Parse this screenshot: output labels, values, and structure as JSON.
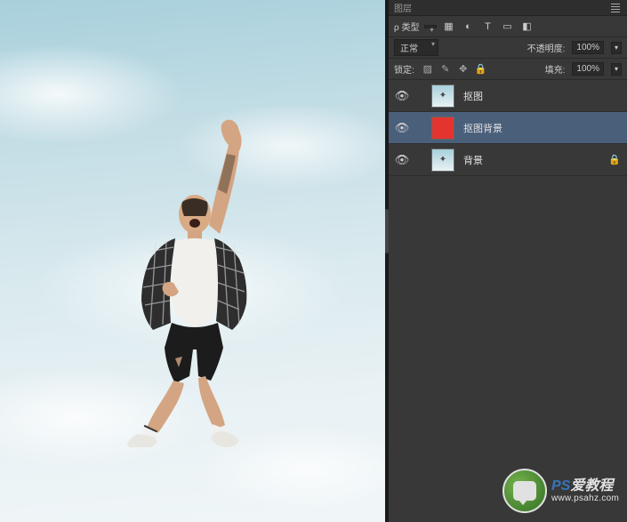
{
  "panel": {
    "tab_label": "图层",
    "filter_label": "ρ 类型",
    "filter_icons": [
      "image-icon",
      "adjustment-icon",
      "text-icon",
      "shape-icon",
      "smartobject-icon"
    ],
    "blend_mode": "正常",
    "opacity_label": "不透明度:",
    "opacity_value": "100%",
    "lock_label": "锁定:",
    "fill_label": "填充:",
    "fill_value": "100%"
  },
  "layers": [
    {
      "name": "抠图",
      "visible": true,
      "thumb": "sky",
      "selected": false,
      "locked": false
    },
    {
      "name": "抠图背景",
      "visible": true,
      "thumb": "red",
      "selected": true,
      "locked": false
    },
    {
      "name": "背景",
      "visible": true,
      "thumb": "sky",
      "selected": false,
      "locked": true
    }
  ],
  "watermark": {
    "title_prefix": "PS",
    "title_suffix": "爱教程",
    "url": "www.psahz.com"
  }
}
